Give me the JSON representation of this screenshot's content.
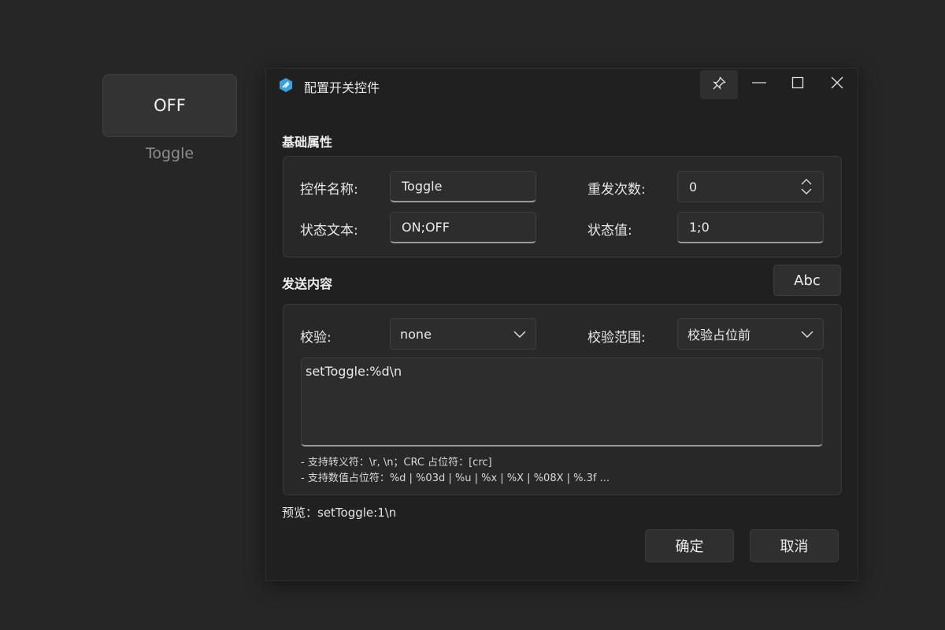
{
  "widget": {
    "state_text": "OFF",
    "caption": "Toggle"
  },
  "dialog": {
    "title": "配置开关控件",
    "icons": {
      "app": "app-logo-icon",
      "pin": "pin-icon",
      "minimize": "minimize-icon",
      "maximize": "maximize-icon",
      "close": "close-icon"
    },
    "basic": {
      "section_title": "基础属性",
      "name_label": "控件名称:",
      "name_value": "Toggle",
      "repeat_label": "重发次数:",
      "repeat_value": "0",
      "state_text_label": "状态文本:",
      "state_text_value": "ON;OFF",
      "state_value_label": "状态值:",
      "state_value_value": "1;0"
    },
    "send": {
      "section_title": "发送内容",
      "abc_button": "Abc",
      "checksum_label": "校验:",
      "checksum_value": "none",
      "range_label": "校验范围:",
      "range_value": "校验占位前",
      "content": "setToggle:%d\\n",
      "hint1": "- 支持转义符：\\r, \\n；CRC 占位符：[crc]",
      "hint2": "- 支持数值占位符：%d | %03d | %u | %x | %X | %08X | %.3f ..."
    },
    "preview": "预览：setToggle:1\\n",
    "ok_button": "确定",
    "cancel_button": "取消"
  },
  "colors": {
    "background": "#262626",
    "dialog_bg": "#202020",
    "group_bg": "#282828",
    "accent_icon": "#3aa0e0"
  }
}
